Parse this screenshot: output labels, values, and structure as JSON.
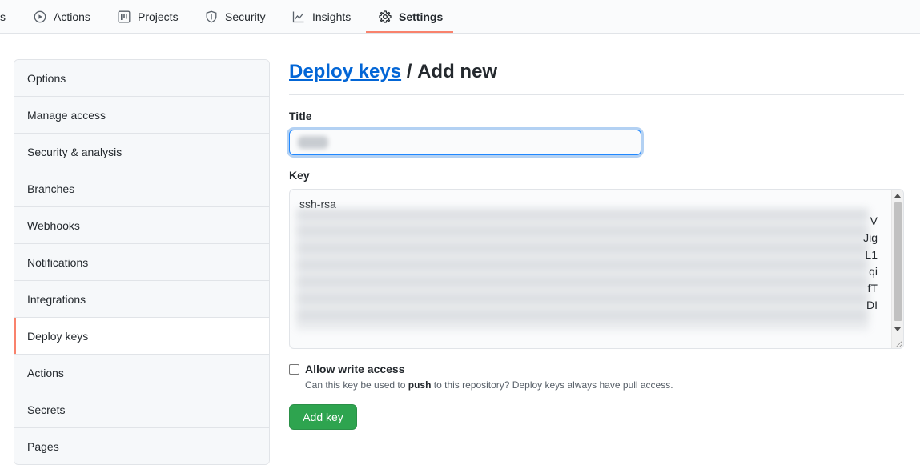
{
  "tabs": [
    {
      "label": "s",
      "icon": "code-icon"
    },
    {
      "label": "Actions",
      "icon": "play-icon"
    },
    {
      "label": "Projects",
      "icon": "project-icon"
    },
    {
      "label": "Security",
      "icon": "shield-icon"
    },
    {
      "label": "Insights",
      "icon": "graph-icon"
    },
    {
      "label": "Settings",
      "icon": "gear-icon",
      "selected": true
    }
  ],
  "sidebar": {
    "items": [
      {
        "label": "Options"
      },
      {
        "label": "Manage access"
      },
      {
        "label": "Security & analysis"
      },
      {
        "label": "Branches"
      },
      {
        "label": "Webhooks"
      },
      {
        "label": "Notifications"
      },
      {
        "label": "Integrations"
      },
      {
        "label": "Deploy keys",
        "selected": true
      },
      {
        "label": "Actions"
      },
      {
        "label": "Secrets"
      },
      {
        "label": "Pages"
      }
    ]
  },
  "main": {
    "heading_link": "Deploy keys",
    "heading_sep": " / ",
    "heading_rest": "Add new",
    "title_label": "Title",
    "key_label": "Key",
    "key_prefix": "ssh-rsa",
    "key_line_tails": [
      "V",
      "Jig",
      "L1",
      "qi",
      "fT",
      "DI"
    ],
    "allow_write_label": "Allow write access",
    "note_pre": "Can this key be used to ",
    "note_bold": "push",
    "note_post": " to this repository? Deploy keys always have pull access.",
    "add_button": "Add key"
  },
  "colors": {
    "accent_tab": "#f9826c",
    "link": "#0366d6",
    "primary_button": "#2ea44f",
    "focus_border": "#2188ff"
  }
}
